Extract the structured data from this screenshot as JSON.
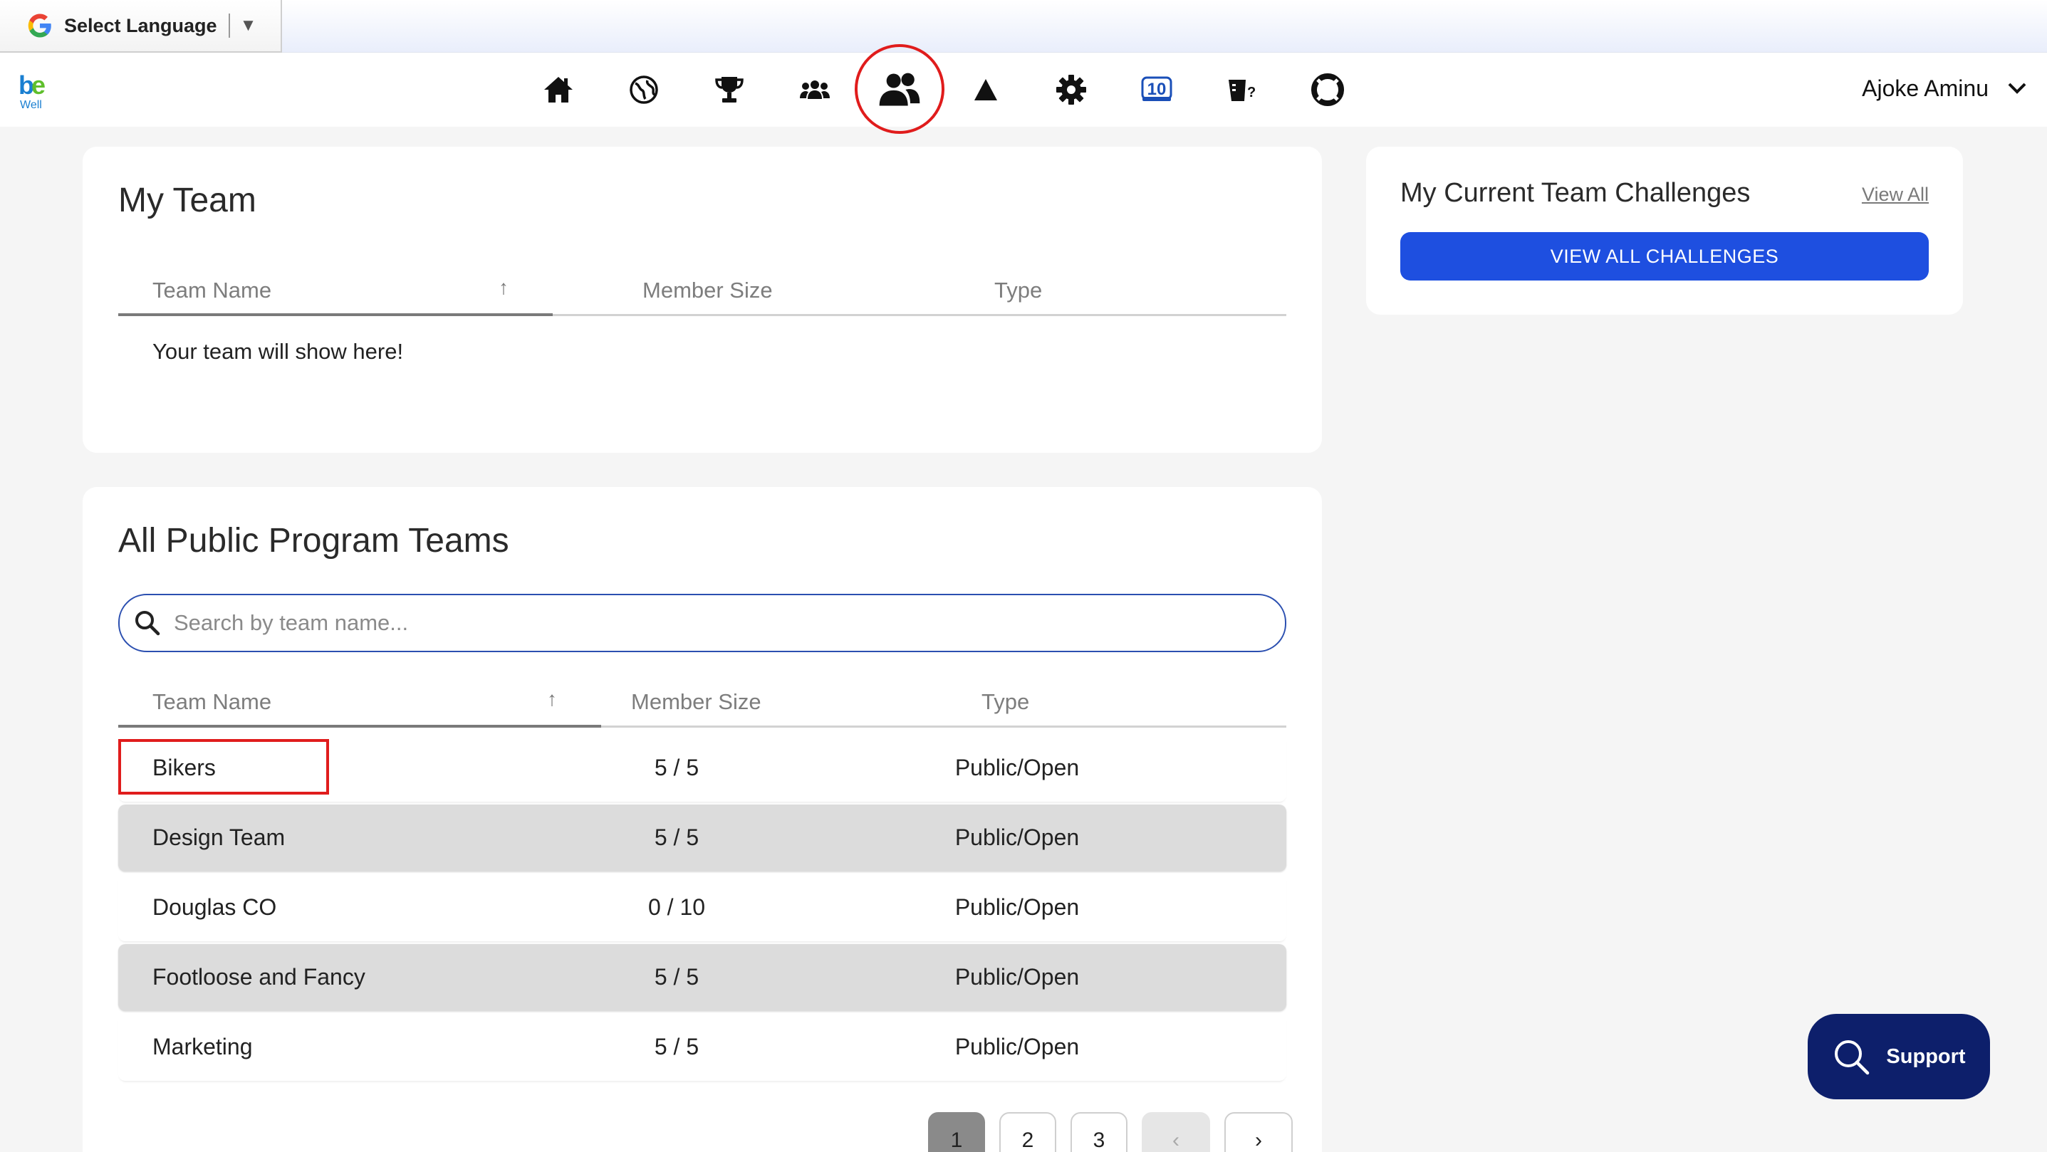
{
  "translate": {
    "label": "Select Language",
    "arrow": "▼"
  },
  "logo": {
    "text": "be",
    "subtext": "Well"
  },
  "nav": {
    "icons": [
      "home-icon",
      "globe-icon",
      "trophy-icon",
      "group-icon",
      "teams-icon",
      "triangle-icon",
      "gear-icon",
      "ten-badge-icon",
      "quiz-icon",
      "lifebuoy-icon"
    ],
    "ten_badge": "10",
    "active": "teams-icon"
  },
  "user": {
    "name": "Ajoke Aminu"
  },
  "my_team": {
    "title": "My Team",
    "columns": [
      "Team Name",
      "Member Size",
      "Type"
    ],
    "empty_message": "Your team will show here!"
  },
  "public_teams": {
    "title": "All Public Program Teams",
    "search_placeholder": "Search by team name...",
    "columns": [
      "Team Name",
      "Member Size",
      "Type"
    ],
    "rows": [
      {
        "name": "Bikers",
        "size": "5 / 5",
        "type": "Public/Open"
      },
      {
        "name": "Design Team",
        "size": "5 / 5",
        "type": "Public/Open"
      },
      {
        "name": "Douglas CO",
        "size": "0 / 10",
        "type": "Public/Open"
      },
      {
        "name": "Footloose and Fancy",
        "size": "5 / 5",
        "type": "Public/Open"
      },
      {
        "name": "Marketing",
        "size": "5 / 5",
        "type": "Public/Open"
      }
    ],
    "pages": [
      "1",
      "2",
      "3"
    ],
    "current_page": "1",
    "prev_label": "‹",
    "next_label": "›"
  },
  "challenges": {
    "title": "My Current Team Challenges",
    "view_all_link": "View All",
    "button_label": "VIEW ALL CHALLENGES"
  },
  "support": {
    "label": "Support"
  },
  "colors": {
    "accent": "#1e4fe0",
    "support_bg": "#0d1f6b",
    "highlight": "#e01c1c"
  }
}
